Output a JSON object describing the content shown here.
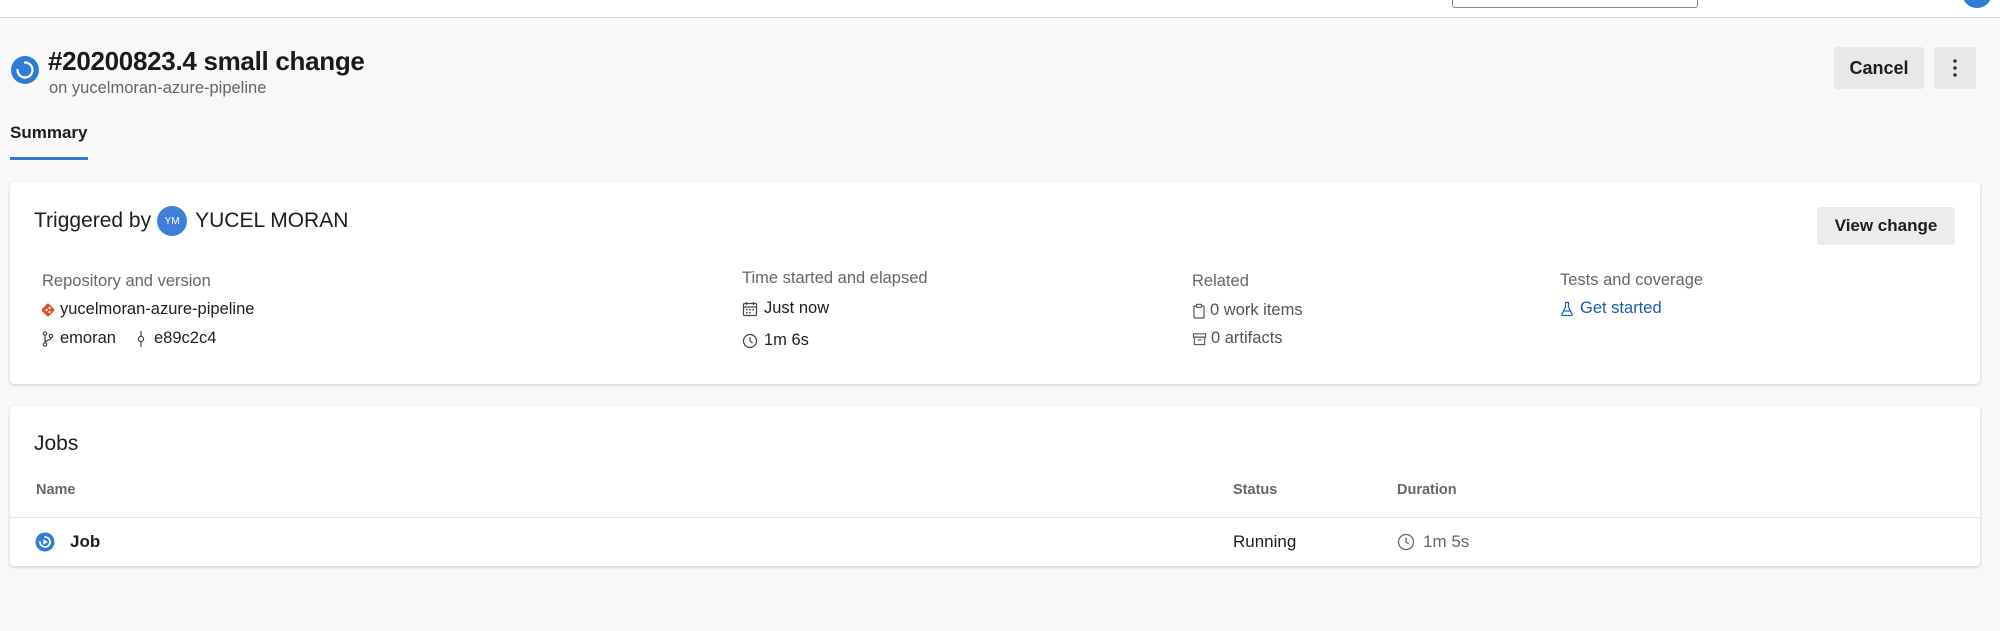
{
  "header": {
    "title": "#20200823.4 small change",
    "subtitle": "on yucelmoran-azure-pipeline",
    "cancel_label": "Cancel",
    "more_label": "⋮"
  },
  "tabs": [
    {
      "label": "Summary",
      "active": true
    }
  ],
  "summary": {
    "triggered_prefix": "Triggered by",
    "user_initials": "YM",
    "user_name": "YUCEL MORAN",
    "view_change_label": "View change",
    "repository": {
      "label": "Repository and version",
      "repo_name": "yucelmoran-azure-pipeline",
      "branch": "emoran",
      "commit": "e89c2c4"
    },
    "time": {
      "label": "Time started and elapsed",
      "started": "Just now",
      "elapsed": "1m 6s"
    },
    "related": {
      "label": "Related",
      "work_items": "0 work items",
      "artifacts": "0 artifacts"
    },
    "tests": {
      "label": "Tests and coverage",
      "link": "Get started"
    }
  },
  "jobs": {
    "title": "Jobs",
    "columns": {
      "name": "Name",
      "status": "Status",
      "duration": "Duration"
    },
    "rows": [
      {
        "name": "Job",
        "status": "Running",
        "duration": "1m 5s"
      }
    ]
  },
  "colors": {
    "accent": "#2f7bd6",
    "link": "#1a5fb4",
    "repo_icon": "#d9512c",
    "background": "#f8f8f8",
    "card": "#ffffff"
  },
  "icons": {
    "run_status": "running-circle-icon",
    "repo": "git-repo-icon",
    "branch": "branch-icon",
    "commit": "commit-icon",
    "calendar": "calendar-icon",
    "clock": "clock-icon",
    "work_item": "clipboard-icon",
    "artifact": "artifact-box-icon",
    "tests": "flask-icon"
  }
}
